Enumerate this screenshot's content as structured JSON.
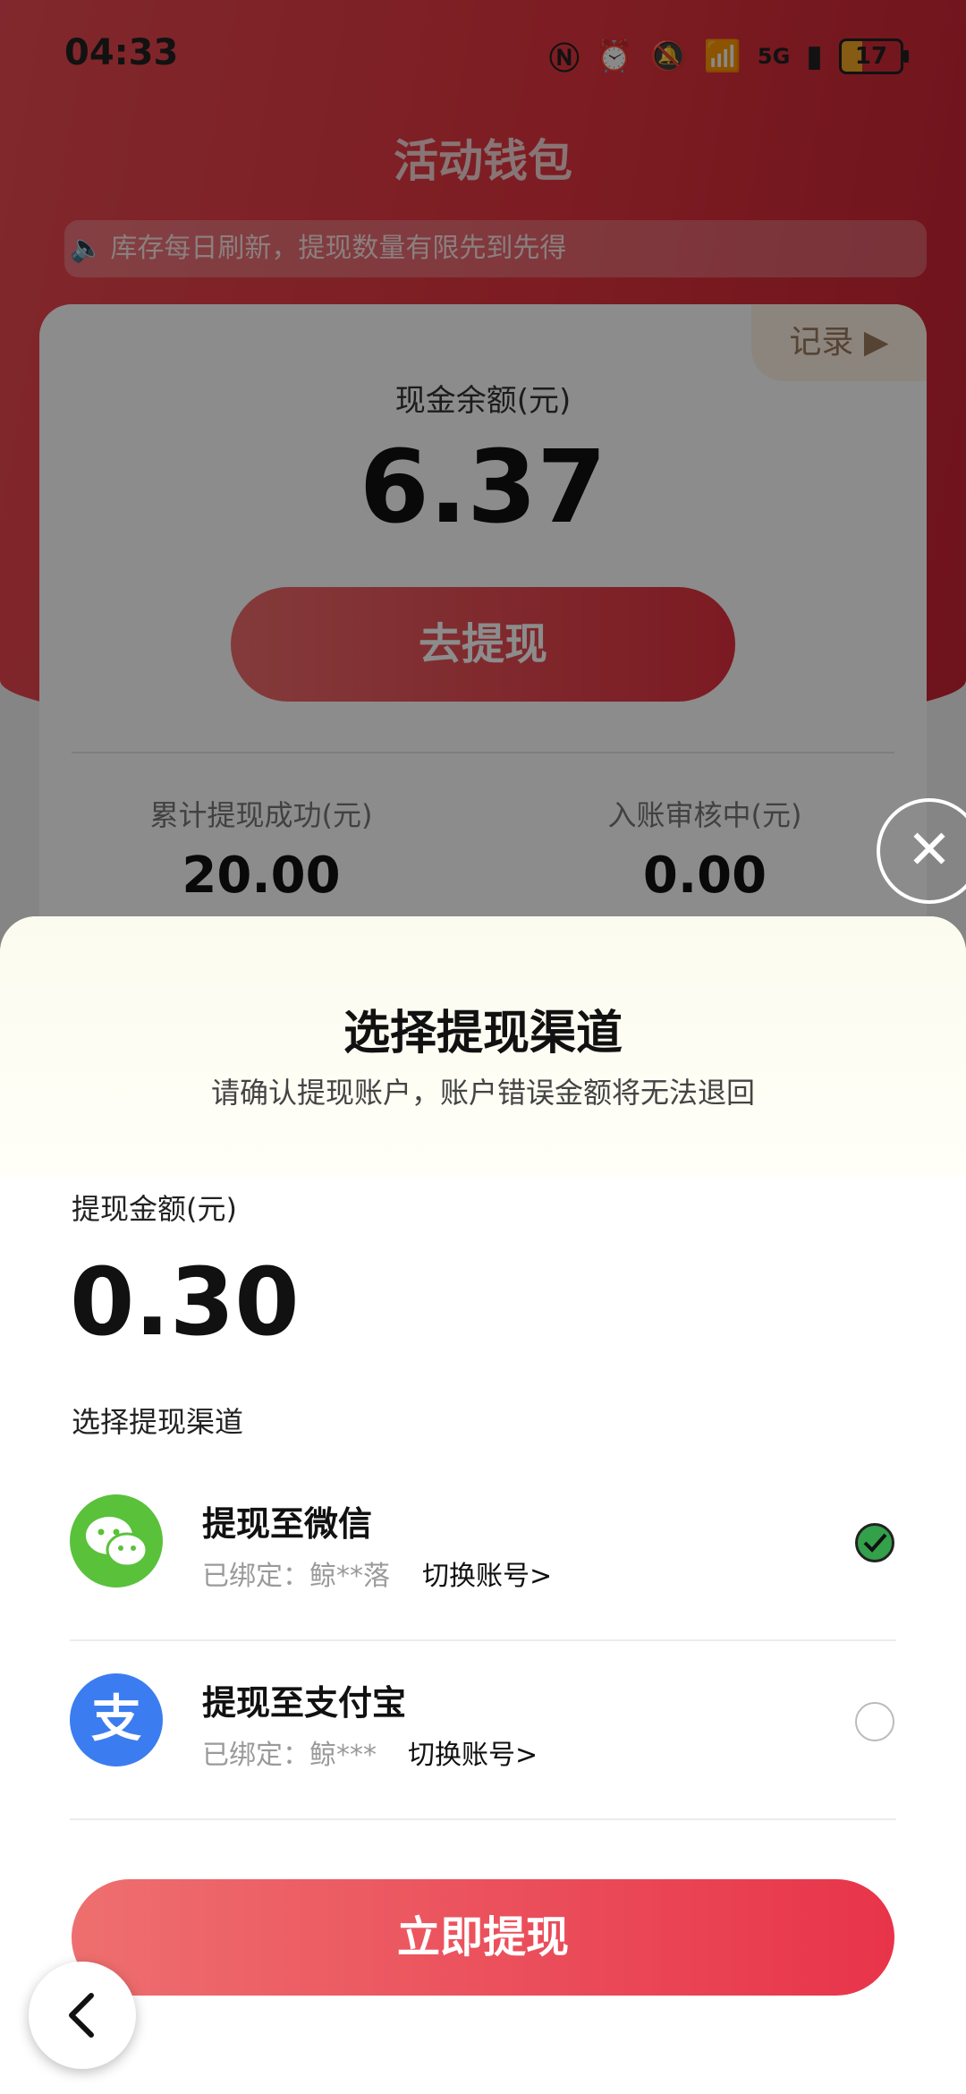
{
  "status_bar": {
    "time": "04:33",
    "network": "5G",
    "battery": "17"
  },
  "header": {
    "title": "活动钱包",
    "notice": "库存每日刷新，提现数量有限先到先得"
  },
  "wallet": {
    "records_label": "记录",
    "balance_label": "现金余额(元)",
    "balance_value": "6.37",
    "withdraw_button": "去提现",
    "stats": [
      {
        "label": "累计提现成功(元)",
        "value": "20.00"
      },
      {
        "label": "入账审核中(元)",
        "value": "0.00"
      }
    ]
  },
  "sheet": {
    "title": "选择提现渠道",
    "subtitle": "请确认提现账户，账户错误金额将无法退回",
    "amount_label": "提现金额(元)",
    "amount_value": "0.30",
    "channel_section_label": "选择提现渠道",
    "channels": [
      {
        "name": "提现至微信",
        "bound": "已绑定：鲸**落",
        "switch": "切换账号>",
        "selected": true,
        "icon": "wechat-icon",
        "color": "#5ac13b"
      },
      {
        "name": "提现至支付宝",
        "bound": "已绑定：鲸***",
        "switch": "切换账号>",
        "selected": false,
        "icon": "alipay-icon",
        "color": "#3b7df0"
      }
    ],
    "confirm_button": "立即提现"
  },
  "colors": {
    "accent_red": "#e3343f",
    "wechat_green": "#5ac13b",
    "alipay_blue": "#3b7df0"
  }
}
